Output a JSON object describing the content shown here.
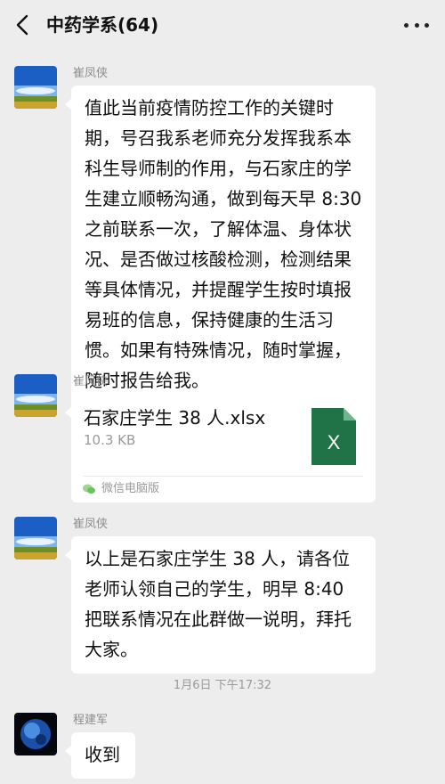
{
  "header": {
    "title": "中药学系(64)"
  },
  "messages": [
    {
      "sender": "崔凤侠",
      "lines": [
        "值此当前疫情防控工作的关键时",
        "期，号召我系老师充分发挥我系本",
        "科生导师制的作用，与石家庄的学",
        "生建立顺畅沟通，做到每天早 8:30",
        "之前联系一次，了解体温、身体状",
        "况、是否做过核酸检测，检测结果",
        "等具体情况，并提醒学生按时填报",
        "易班的信息，保持健康的生活习",
        "惯。如果有特殊情况，随时掌握，",
        "随时报告给我。"
      ]
    },
    {
      "sender": "崔凤侠",
      "file": {
        "name": "石家庄学生 38 人.xlsx",
        "size": "10.3 KB",
        "icon_letter": "X",
        "source": "微信电脑版"
      }
    },
    {
      "sender": "崔凤侠",
      "lines": [
        "以上是石家庄学生 38 人，请各位",
        "老师认领自己的学生，明早 8:40",
        "把联系情况在此群做一说明，拜托",
        "大家。"
      ]
    },
    {
      "sender": "程建军",
      "lines": [
        "收到"
      ]
    }
  ],
  "timestamp": "1月6日 下午17:32",
  "colors": {
    "background": "#ededed",
    "bubble": "#ffffff",
    "excel_green": "#1f7346"
  }
}
